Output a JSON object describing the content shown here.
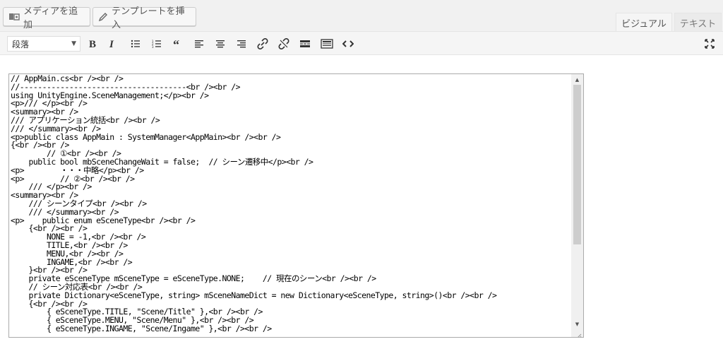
{
  "top": {
    "add_media_label": "メディアを追加",
    "add_template_label": "テンプレートを挿入",
    "tab_visual": "ビジュアル",
    "tab_text": "テキスト"
  },
  "toolbar": {
    "format_value": "段落",
    "buttons": [
      "bold-icon",
      "italic-icon",
      "bulleted-list-icon",
      "numbered-list-icon",
      "blockquote-icon",
      "align-left-icon",
      "align-center-icon",
      "align-right-icon",
      "link-icon",
      "unlink-icon",
      "read-more-icon",
      "toolbar-toggle-icon",
      "code-icon",
      "fullscreen-icon"
    ]
  },
  "code": {
    "lines": [
      "// AppMain.cs<br /><br />",
      "//-------------------------------------<br /><br />",
      "using UnityEngine.SceneManagement;</p><br />",
      "<p>/// </p><br />",
      "<summary><br />",
      "/// アプリケーション統括<br /><br />",
      "/// </summary><br />",
      "<p>public class AppMain : SystemManager<AppMain><br /><br />",
      "{<br /><br />",
      "        // ①<br /><br />",
      "    public bool mbSceneChangeWait = false;  // シーン遷移中</p><br />",
      "<p>        ・・・中略</p><br />",
      "<p>        // ②<br /><br />",
      "    /// </p><br />",
      "<summary><br />",
      "    /// シーンタイプ<br /><br />",
      "    /// </summary><br />",
      "<p>    public enum eSceneType<br /><br />",
      "    {<br /><br />",
      "        NONE = -1,<br /><br />",
      "        TITLE,<br /><br />",
      "        MENU,<br /><br />",
      "        INGAME,<br /><br />",
      "    }<br /><br />",
      "    private eSceneType mSceneType = eSceneType.NONE;    // 現在のシーン<br /><br />",
      "    // シーン対応表<br /><br />",
      "    private Dictionary<eSceneType, string> mSceneNameDict = new Dictionary<eSceneType, string>()<br /><br />",
      "    {<br /><br />",
      "        { eSceneType.TITLE, \"Scene/Title\" },<br /><br />",
      "        { eSceneType.MENU, \"Scene/Menu\" },<br /><br />",
      "        { eSceneType.INGAME, \"Scene/Ingame\" },<br /><br />"
    ]
  }
}
